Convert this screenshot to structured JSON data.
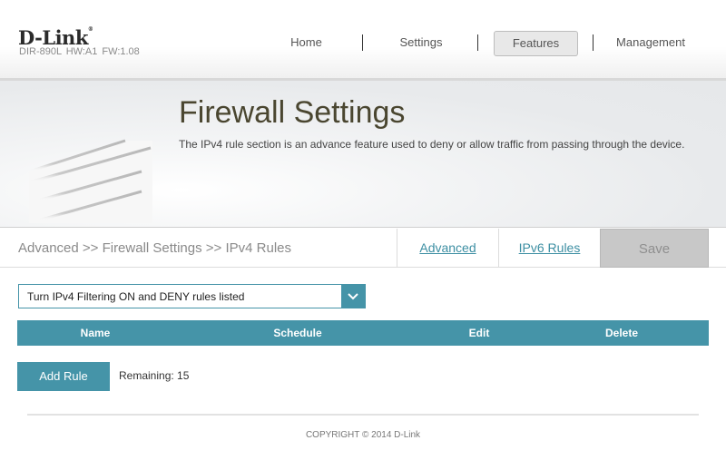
{
  "header": {
    "logo": "D-Link",
    "logo_mark": "®",
    "model_info": "DIR-890L   HW:A1   FW:1.08",
    "nav": [
      {
        "label": "Home",
        "active": false
      },
      {
        "label": "Settings",
        "active": false
      },
      {
        "label": "Features",
        "active": true
      },
      {
        "label": "Management",
        "active": false
      }
    ]
  },
  "banner": {
    "title": "Firewall Settings",
    "description": "The IPv4 rule section is an advance feature used to deny or allow traffic from passing through the device.",
    "icon": "brick-wall-icon"
  },
  "subbar": {
    "breadcrumb": "Advanced >> Firewall Settings >> IPv4 Rules",
    "links": [
      "Advanced",
      "IPv6 Rules"
    ],
    "save_label": "Save"
  },
  "filter": {
    "selected": "Turn IPv4 Filtering ON and DENY rules listed"
  },
  "table": {
    "columns": [
      "Name",
      "Schedule",
      "Edit",
      "Delete"
    ],
    "rows": []
  },
  "actions": {
    "add_rule_label": "Add Rule",
    "remaining": "Remaining: 15"
  },
  "footer": {
    "copyright": "COPYRIGHT © 2014 D-Link"
  },
  "colors": {
    "accent": "#4594a8",
    "link": "#3d8fa3",
    "save_disabled": "#c8c8c8"
  }
}
